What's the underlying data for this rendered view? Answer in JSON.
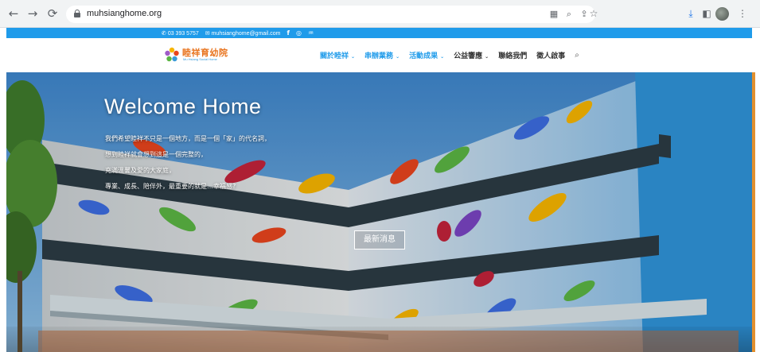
{
  "browser": {
    "url": "muhsianghome.org",
    "back_icon": "arrow-left",
    "forward_icon": "arrow-right",
    "reload_icon": "reload",
    "toolbar_icons": [
      "translate-icon",
      "zoom-icon",
      "share-icon",
      "bookmark-star-icon",
      "download-icon",
      "sidebar-icon",
      "profile-avatar",
      "kebab-menu-icon"
    ]
  },
  "topbar": {
    "phone": "03 393 5757",
    "email": "muhsianghome@gmail.com",
    "social": [
      "f",
      "instagram",
      "rss"
    ],
    "bg_color": "#1f9bea"
  },
  "header": {
    "logo_text": "睦祥育幼院",
    "logo_subtext": "Mu Hsiang Social Home",
    "menu": [
      {
        "label": "關於睦祥",
        "dropdown": true
      },
      {
        "label": "串辦業務",
        "dropdown": true
      },
      {
        "label": "活動成果",
        "dropdown": true
      },
      {
        "label": "公益響應",
        "dropdown": true
      },
      {
        "label": "聯絡我們",
        "dropdown": false
      },
      {
        "label": "徵人啟事",
        "dropdown": false
      }
    ],
    "accent_color": "#1f9bea"
  },
  "hero": {
    "title": "Welcome Home",
    "lines": [
      "我們希望睦祥不只是一個地方，而是一個「家」的代名詞，",
      "想到睦祥就會想到這是一個完整的，",
      "充滿溫馨及愛的大家庭，",
      "專業、成長、陪伴外，最重要的就是…幸福感?"
    ],
    "button_label": "最新消息"
  }
}
